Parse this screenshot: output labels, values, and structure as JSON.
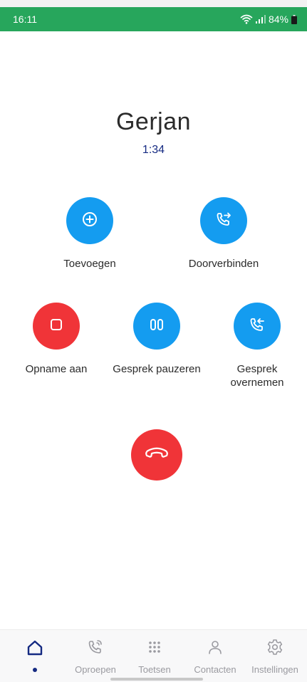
{
  "status_bar": {
    "time": "16:11",
    "battery": "84%"
  },
  "call": {
    "caller_name": "Gerjan",
    "duration": "1:34"
  },
  "actions": {
    "add": {
      "label": "Toevoegen",
      "icon": "plus-circle-icon"
    },
    "transfer": {
      "label": "Doorverbinden",
      "icon": "call-transfer-icon"
    },
    "record": {
      "label": "Opname aan",
      "icon": "stop-icon"
    },
    "hold": {
      "label": "Gesprek pauzeren",
      "icon": "pause-icon"
    },
    "takeover": {
      "label_line1": "Gesprek",
      "label_line2": "overnemen",
      "icon": "call-takeover-icon"
    },
    "hangup": {
      "icon": "hang-up-icon"
    }
  },
  "nav": {
    "items": [
      {
        "label": "",
        "icon": "home-icon",
        "active": true
      },
      {
        "label": "Oproepen",
        "icon": "phone-calls-icon"
      },
      {
        "label": "Toetsen",
        "icon": "dialpad-icon"
      },
      {
        "label": "Contacten",
        "icon": "person-icon"
      },
      {
        "label": "Instellingen",
        "icon": "gear-icon"
      }
    ]
  },
  "colors": {
    "status_bar": "#27a65c",
    "action_blue": "#149cf0",
    "action_red": "#f03438",
    "accent_navy": "#152a82"
  }
}
